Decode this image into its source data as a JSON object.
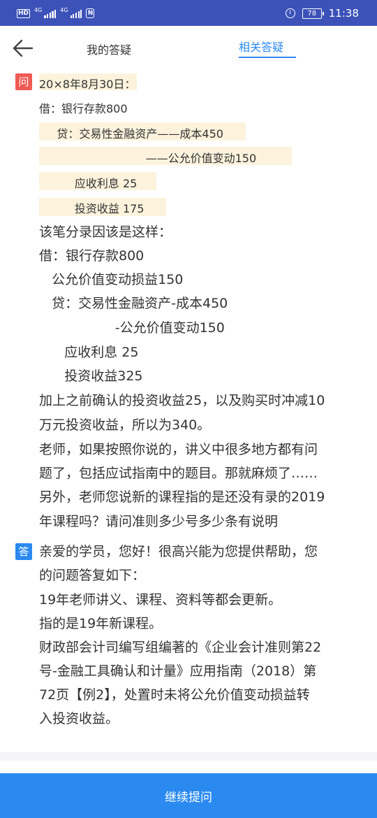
{
  "status_bar": {
    "hd": "HD",
    "signal1": "4G",
    "signal2": "4G",
    "nfc": "N",
    "battery": "78",
    "time": "11:38",
    "bg_color": "#3c52b8"
  },
  "nav": {
    "back_icon": "arrow-left",
    "tabs": [
      {
        "label": "我的答疑",
        "active": false
      },
      {
        "label": "相关答疑",
        "active": true
      }
    ],
    "accent_color": "#2b8af0"
  },
  "question": {
    "badge": "问",
    "highlighted_lines": [
      "20×8年8月30日：",
      "借：银行存款800",
      "     贷：交易性金融资产——成本450",
      "                              ——公允价值变动150",
      "          应收利息 25",
      "          投资收益 175"
    ],
    "lines": [
      "该笔分录因该是这样：",
      "借：银行存款800",
      "   公允价值变动损益150",
      "   贷：交易性金融资产-成本450",
      "                  -公允价值变动150",
      "      应收利息 25",
      "      投资收益325",
      "加上之前确认的投资收益25，以及购买时冲减10",
      "万元投资收益，所以为340。",
      "老师，如果按照你说的，讲义中很多地方都有问",
      "题了，包括应试指南中的题目。那就麻烦了……",
      "另外，老师您说新的课程指的是还没有录的2019",
      "年课程吗？请问准则多少号多少条有说明"
    ]
  },
  "answer": {
    "badge": "答",
    "lines": [
      "亲爱的学员，您好！很高兴能为您提供帮助，您",
      "的问题答复如下：",
      "19年老师讲义、课程、资料等都会更新。",
      "指的是19年新课程。",
      "财政部会计司编写组编著的《企业会计准则第22",
      "号-金融工具确认和计量》应用指南（2018）第",
      "72页【例2】，处置时未将公允价值变动损益转",
      "入投资收益。"
    ]
  },
  "footer": {
    "continue_label": "继续提问"
  }
}
